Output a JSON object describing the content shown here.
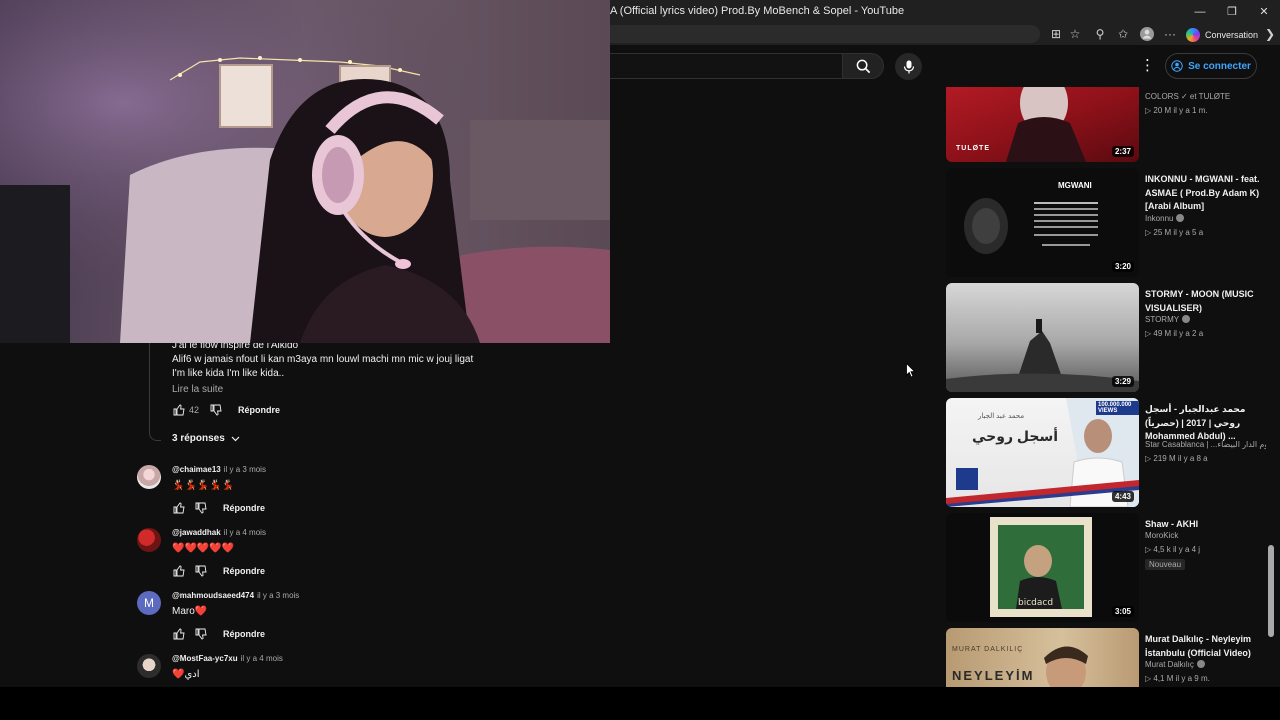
{
  "window": {
    "title": "A (Official lyrics video) Prod.By MoBench & Sopel - YouTube"
  },
  "browser": {
    "conversation_label": "Conversation"
  },
  "header": {
    "signin_label": "Se connecter"
  },
  "comments": {
    "main_partial": {
      "line1": "J'ai le flow inspiré de l'Alkido",
      "line2": "Alif6 w jamais nfout li kan m3aya mn louwl machi mn mic w jouj ligat",
      "line3": "I'm like kida I'm like kida..",
      "read_more": "Lire la suite",
      "likes": "42",
      "reply": "Répondre",
      "replies_toggle": "3 réponses"
    },
    "items": [
      {
        "user": "@chaimae13",
        "time": "il y a 3 mois",
        "text": "💃🏻💃🏻💃🏻💃🏻💃🏻",
        "reply": "Répondre"
      },
      {
        "user": "@jawaddhak",
        "time": "il y a 4 mois",
        "text": "❤️❤️❤️❤️❤️",
        "reply": "Répondre"
      },
      {
        "user": "@mahmoudsaeed474",
        "time": "il y a 3 mois",
        "text": "Maro❤️",
        "reply": "Répondre",
        "initial": "M"
      },
      {
        "user": "@MostFaa-yc7xu",
        "time": "il y a 4 mois",
        "text": "❤️ادي"
      }
    ]
  },
  "sidebar": {
    "items": [
      {
        "title": "",
        "channel": "COLORS ✓ et TULØTE",
        "meta": "▷ 20 M    il y a 1 m.",
        "duration": "2:37",
        "thumb_label": "TULØTE"
      },
      {
        "title": "INKONNU - MGWANI - feat. ASMAE ( Prod.By Adam K) [Arabi Album]",
        "channel": "Inkonnu",
        "meta": "▷ 25 M    il y a 5 a",
        "duration": "3:20",
        "thumb_label": "MGWANI"
      },
      {
        "title": "STORMY - MOON (MUSIC VISUALISER)",
        "channel": "STORMY",
        "meta": "▷ 49 M    il y a 2 a",
        "duration": "3:29"
      },
      {
        "title": "محمد عبدالجبار - أسجل روحي | 2017 | (حصرياً) Mohammed Abdul) ...",
        "channel": "Star Casablanca | ...وم الدار البيضاء",
        "meta": "▷ 219 M    il y a 8 a",
        "duration": "4:43",
        "thumb_label": "أسجل روحي",
        "views_badge": "100.000.000 VIEWS",
        "sub_label": "محمد عبد الجبار"
      },
      {
        "title": "Shaw - AKHI",
        "channel": "MoroKick",
        "meta": "▷ 4,5 k    il y a 4 j",
        "duration": "3:05",
        "badge": "Nouveau"
      },
      {
        "title": "Murat Dalkılıç - Neyleyim İstanbulu (Official Video)",
        "channel": "Murat Dalkılıç",
        "meta": "▷ 4,1 M    il y a 9 m.",
        "thumb_label": "NEYLEYİM",
        "thumb_sub": "MURAT DALKILIÇ"
      }
    ]
  }
}
